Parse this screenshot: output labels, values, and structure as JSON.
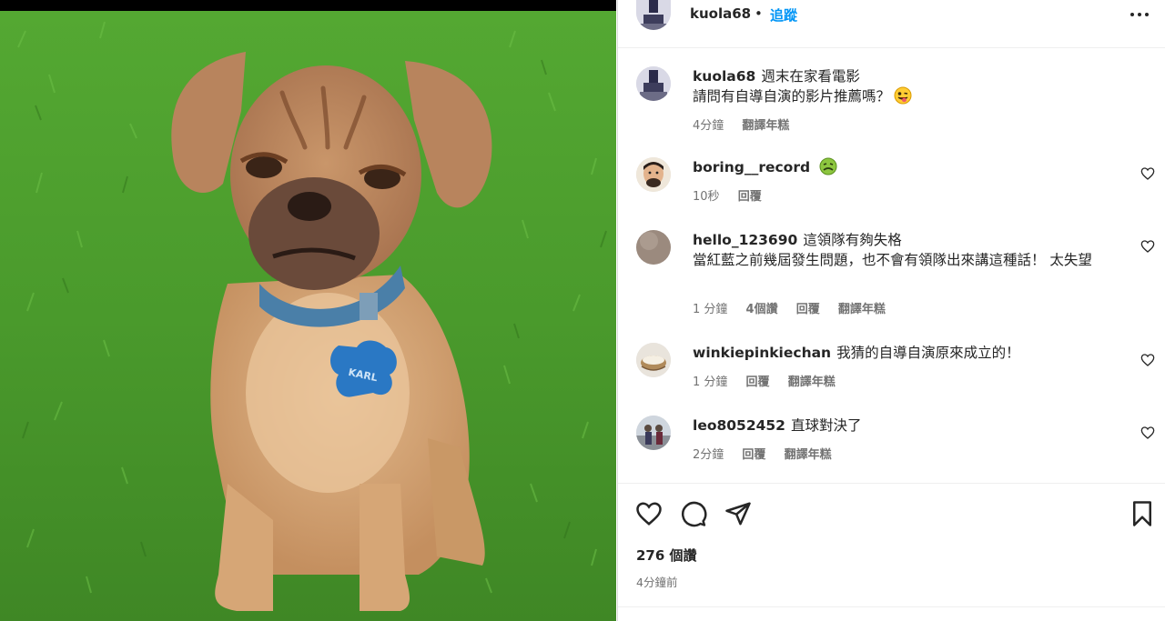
{
  "post": {
    "image_alt": "Puppy with grumpy face sitting on grass, blue collar with KARL tag",
    "tag_text": "KARL"
  },
  "header": {
    "username": "kuola68",
    "separator": "•",
    "follow_label": "追蹤"
  },
  "caption": {
    "username": "kuola68",
    "line1": "週末在家看電影",
    "line2": "請問有自導自演的影片推薦嗎？",
    "time": "4分鐘",
    "translate": "翻譯年糕"
  },
  "comments": [
    {
      "username": "boring__record",
      "text": "",
      "time": "10秒",
      "reply": "回覆"
    },
    {
      "username": "hello_123690",
      "text": "這領隊有夠失格",
      "text2": "當紅藍之前幾屆發生問題，也不會有領隊出來講這種話！ 太失望",
      "time": "1 分鐘",
      "likes": "4個讚",
      "reply": "回覆",
      "translate": "翻譯年糕"
    },
    {
      "username": "winkiepinkiechan",
      "text": "我猜的自導自演原來成立的！",
      "time": "1 分鐘",
      "reply": "回覆",
      "translate": "翻譯年糕"
    },
    {
      "username": "leo8052452",
      "text": "直球對決了",
      "time": "2分鐘",
      "reply": "回覆",
      "translate": "翻譯年糕"
    }
  ],
  "footer": {
    "likes": "276 個讚",
    "time": "4分鐘前"
  },
  "icons": {
    "like": "heart-icon",
    "comment": "comment-icon",
    "share": "share-icon",
    "save": "bookmark-icon",
    "more": "more-icon"
  }
}
